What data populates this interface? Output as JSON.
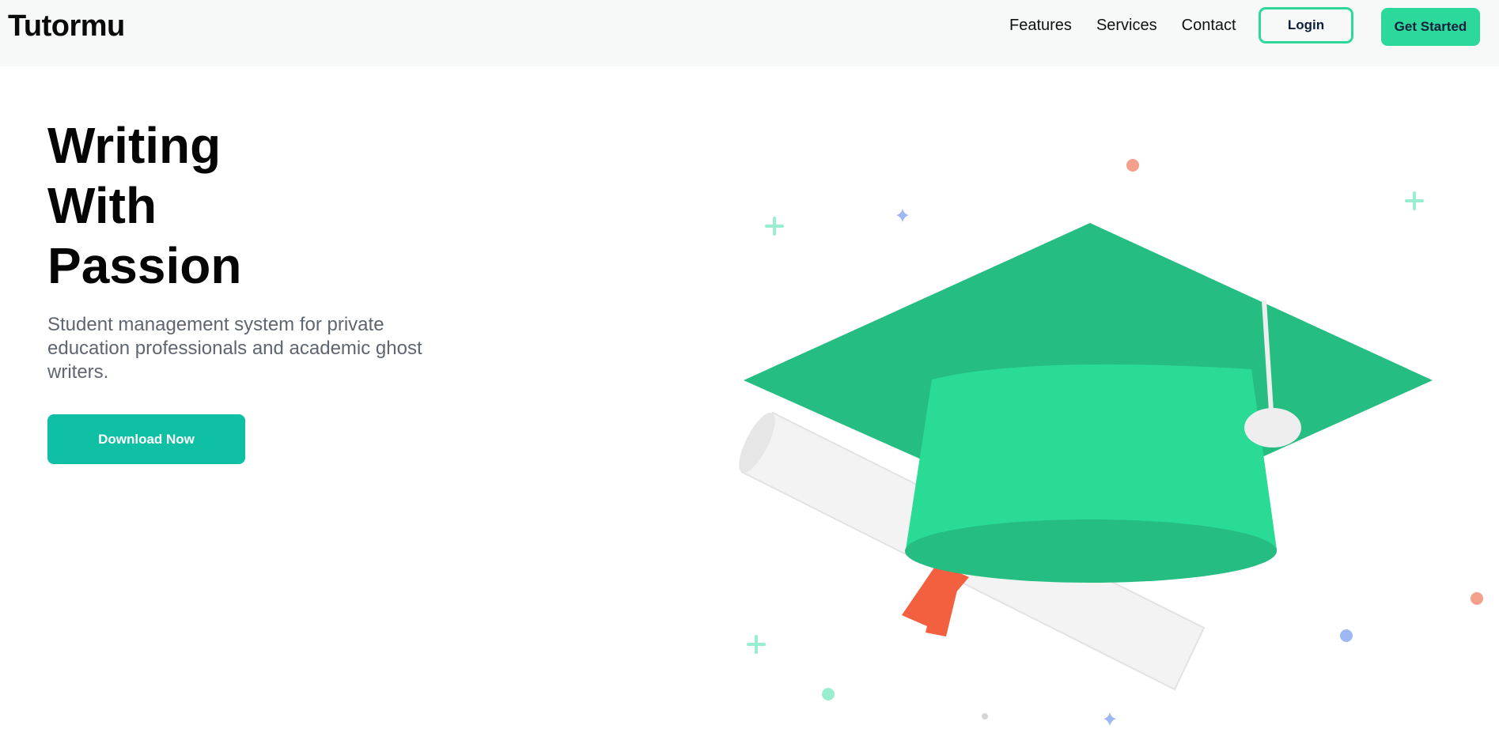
{
  "navbar": {
    "brand": "Tutormu",
    "links": [
      "Features",
      "Services",
      "Contact"
    ],
    "login_label": "Login",
    "get_started_label": "Get Started"
  },
  "hero": {
    "title_lines": [
      "Writing",
      "With",
      "Passion"
    ],
    "subtitle": "Student management system for private education professionals and academic ghost writers.",
    "download_label": "Download Now"
  },
  "illustration": {
    "icon": "graduation-cap-diploma-icon",
    "colors": {
      "cap_top": "#25bd82",
      "cap_body": "#2adb95",
      "diploma": "#f2f2f2",
      "ribbon": "#f2603f",
      "accent_coral": "#f4a08c",
      "accent_blue": "#9db8f2",
      "accent_mint": "#9aeed0"
    }
  },
  "colors": {
    "brand_green": "#2cd99a",
    "download_teal": "#10c0a4",
    "nav_bg": "#f7f9f8"
  }
}
